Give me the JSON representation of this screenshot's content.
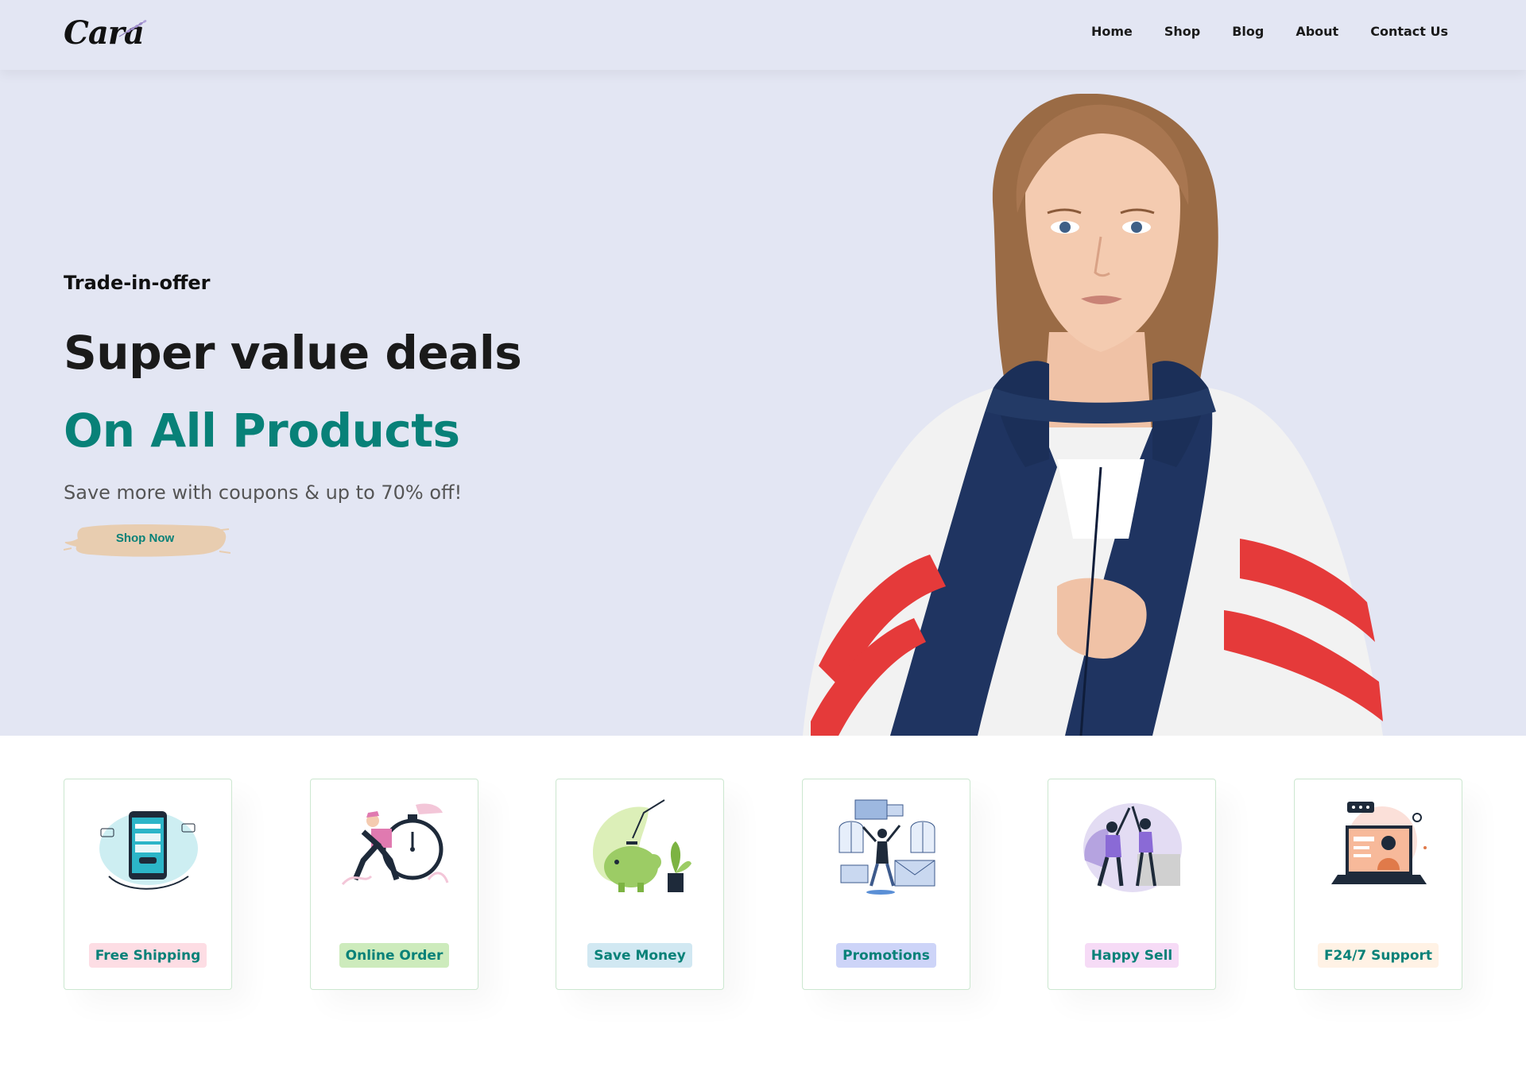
{
  "brand": {
    "logo_text": "Cara"
  },
  "nav": {
    "items": [
      {
        "label": "Home"
      },
      {
        "label": "Shop"
      },
      {
        "label": "Blog"
      },
      {
        "label": "About"
      },
      {
        "label": "Contact Us"
      }
    ]
  },
  "hero": {
    "kicker": "Trade-in-offer",
    "title": "Super value deals",
    "subtitle": "On All Products",
    "description": "Save more with coupons & up to 70% off!",
    "button_label": "Shop Now"
  },
  "features": [
    {
      "label": "Free Shipping",
      "icon": "payment-phone-icon",
      "tag_color": "#fddde4"
    },
    {
      "label": "Online Order",
      "icon": "delivery-stopwatch-icon",
      "tag_color": "#cdebbc"
    },
    {
      "label": "Save Money",
      "icon": "piggy-bank-icon",
      "tag_color": "#d1e8f2"
    },
    {
      "label": "Promotions",
      "icon": "promotion-mail-icon",
      "tag_color": "#cdd4f8"
    },
    {
      "label": "Happy Sell",
      "icon": "high-five-icon",
      "tag_color": "#f6dbf6"
    },
    {
      "label": "F24/7 Support",
      "icon": "support-laptop-icon",
      "tag_color": "#fff2e5"
    }
  ],
  "colors": {
    "accent": "#088178",
    "hero_bg": "#e3e6f3",
    "brush": "#e8cdb0"
  }
}
